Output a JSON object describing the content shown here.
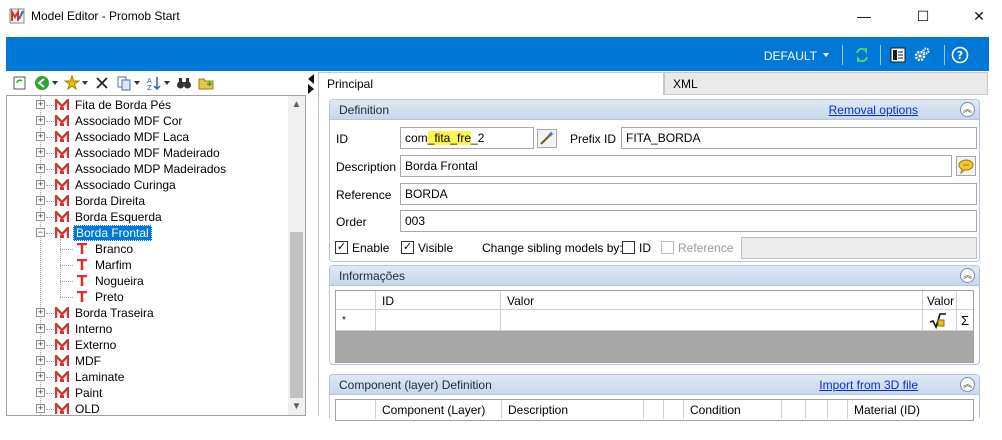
{
  "window": {
    "title": "Model Editor - Promob Start",
    "minimize": "—",
    "maximize": "☐",
    "close": "✕"
  },
  "toolbar": {
    "profile_label": "DEFAULT"
  },
  "tree": {
    "items": [
      {
        "label": "Fita de Borda Pés",
        "level": 0,
        "type": "model"
      },
      {
        "label": "Associado MDF Cor",
        "level": 0,
        "type": "model"
      },
      {
        "label": "Associado MDF Laca",
        "level": 0,
        "type": "model"
      },
      {
        "label": "Associado MDF Madeirado",
        "level": 0,
        "type": "model"
      },
      {
        "label": "Associado MDP Madeirados",
        "level": 0,
        "type": "model"
      },
      {
        "label": "Associado Curinga",
        "level": 0,
        "type": "model"
      },
      {
        "label": "Borda Direita",
        "level": 0,
        "type": "model"
      },
      {
        "label": "Borda Esquerda",
        "level": 0,
        "type": "model"
      },
      {
        "label": "Borda Frontal",
        "level": 0,
        "type": "model",
        "selected": true,
        "expanded": true
      },
      {
        "label": "Branco",
        "level": 1,
        "type": "texture"
      },
      {
        "label": "Marfim",
        "level": 1,
        "type": "texture"
      },
      {
        "label": "Nogueira",
        "level": 1,
        "type": "texture"
      },
      {
        "label": "Preto",
        "level": 1,
        "type": "texture"
      },
      {
        "label": "Borda Traseira",
        "level": 0,
        "type": "model"
      },
      {
        "label": "Interno",
        "level": 0,
        "type": "model"
      },
      {
        "label": "Externo",
        "level": 0,
        "type": "model"
      },
      {
        "label": "MDF",
        "level": 0,
        "type": "model"
      },
      {
        "label": "Laminate",
        "level": 0,
        "type": "model"
      },
      {
        "label": "Paint",
        "level": 0,
        "type": "model"
      },
      {
        "label": "OLD",
        "level": 0,
        "type": "model"
      }
    ]
  },
  "tabs": [
    {
      "label": "Principal",
      "active": true
    },
    {
      "label": "XML",
      "active": false
    }
  ],
  "definition": {
    "title": "Definition",
    "link": "Removal options",
    "id_label": "ID",
    "id_value_prefix": "com",
    "id_value_highlight1": "_fita_",
    "id_value_mid": "fre",
    "id_value_suffix": "_2",
    "prefix_id_label": "Prefix ID",
    "prefix_id_value": "FITA_BORDA",
    "description_label": "Description",
    "description_value": "Borda Frontal",
    "reference_label": "Reference",
    "reference_value": "BORDA",
    "order_label": "Order",
    "order_value": "003",
    "enable_label": "Enable",
    "visible_label": "Visible",
    "change_sibling_label": "Change sibling models by:",
    "sibling_id_label": "ID",
    "sibling_reference_label": "Reference"
  },
  "informacoes": {
    "title": "Informações",
    "columns": [
      "ID",
      "Valor",
      "Valor"
    ],
    "new_row_marker": "*",
    "sum_symbol": "Σ"
  },
  "component_definition": {
    "title": "Component (layer) Definition",
    "link": "Import from 3D file",
    "columns": [
      "Component (Layer)",
      "Description",
      "Condition",
      "Material (ID)"
    ]
  },
  "colors": {
    "accent_blue": "#0078d7",
    "selection_blue": "#0078d7",
    "highlight_yellow": "#fff34d",
    "model_icon_red": "#d9342b"
  }
}
